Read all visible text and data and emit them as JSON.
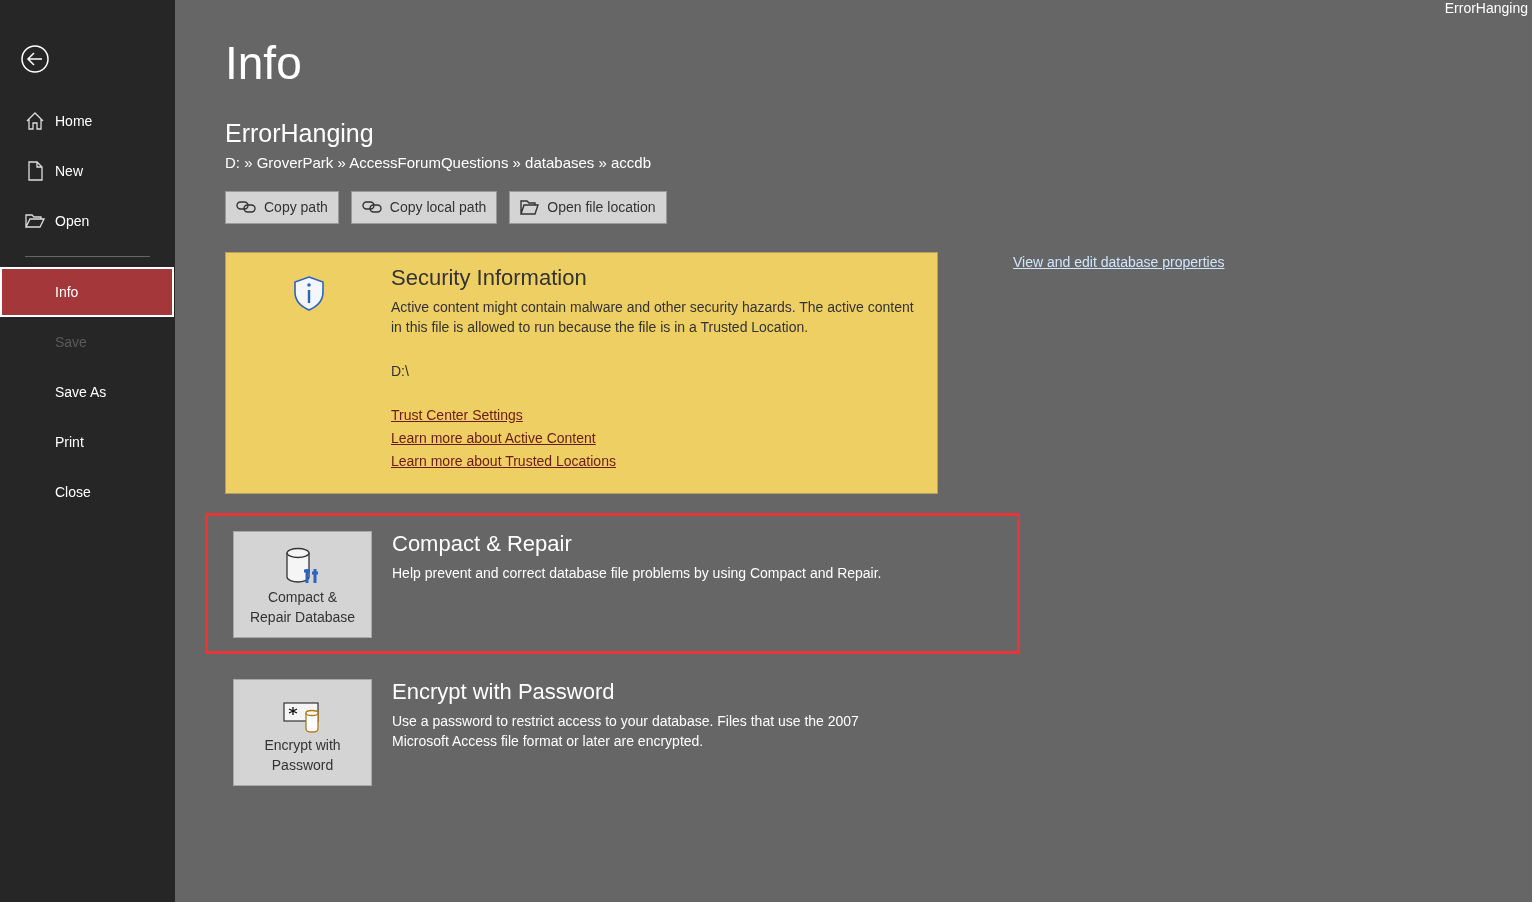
{
  "window": {
    "title": "ErrorHanging"
  },
  "sidebar": {
    "items": [
      {
        "label": "Home",
        "kind": "home",
        "selected": false,
        "disabled": false
      },
      {
        "label": "New",
        "kind": "new",
        "selected": false,
        "disabled": false
      },
      {
        "label": "Open",
        "kind": "open",
        "selected": false,
        "disabled": false
      },
      {
        "label": "Info",
        "kind": "plain",
        "selected": true,
        "disabled": false
      },
      {
        "label": "Save",
        "kind": "plain",
        "selected": false,
        "disabled": true
      },
      {
        "label": "Save As",
        "kind": "plain",
        "selected": false,
        "disabled": false
      },
      {
        "label": "Print",
        "kind": "plain",
        "selected": false,
        "disabled": false
      },
      {
        "label": "Close",
        "kind": "plain",
        "selected": false,
        "disabled": false
      }
    ]
  },
  "page": {
    "heading": "Info",
    "file_name": "ErrorHanging",
    "path": "D: » GroverPark » AccessForumQuestions » databases » accdb",
    "path_buttons": [
      {
        "label": "Copy path",
        "kind": "link"
      },
      {
        "label": "Copy local path",
        "kind": "link"
      },
      {
        "label": "Open file location",
        "kind": "folder"
      }
    ],
    "properties_link": "View and edit database properties"
  },
  "security": {
    "title": "Security Information",
    "text": "Active content might contain malware and other security hazards. The active content in this file is allowed to run because the file is in a Trusted Location.",
    "location": "D:\\",
    "links": [
      "Trust Center Settings",
      "Learn more about Active Content",
      "Learn more about Trusted Locations"
    ]
  },
  "sections": [
    {
      "kind": "compact",
      "button": "Compact & Repair Database",
      "title": "Compact & Repair",
      "text": "Help prevent and correct database file problems by using Compact and Repair.",
      "highlighted": true
    },
    {
      "kind": "encrypt",
      "button": "Encrypt with Password",
      "title": "Encrypt with Password",
      "text": "Use a password to restrict access to your database. Files that use the 2007 Microsoft Access file format or later are encrypted.",
      "highlighted": false
    }
  ]
}
